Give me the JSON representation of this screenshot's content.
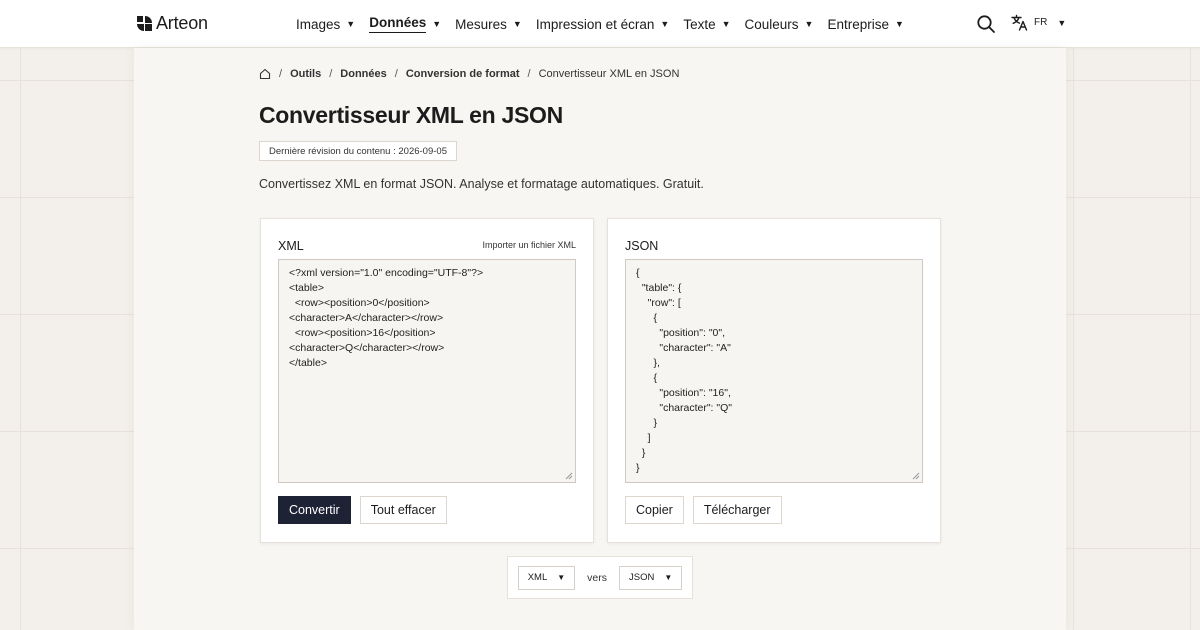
{
  "brand": {
    "name": "Arteon"
  },
  "nav": {
    "items": [
      {
        "label": "Images",
        "active": false
      },
      {
        "label": "Données",
        "active": true
      },
      {
        "label": "Mesures",
        "active": false
      },
      {
        "label": "Impression et écran",
        "active": false
      },
      {
        "label": "Texte",
        "active": false
      },
      {
        "label": "Couleurs",
        "active": false
      },
      {
        "label": "Entreprise",
        "active": false
      }
    ],
    "caret": "▼",
    "language": "FR"
  },
  "breadcrumb": {
    "items": [
      "Outils",
      "Données",
      "Conversion de format"
    ],
    "current": "Convertisseur XML en JSON",
    "separator": "/"
  },
  "page": {
    "title": "Convertisseur XML en JSON",
    "revision": "Dernière révision du contenu : 2026-09-05",
    "intro": "Convertissez XML en format JSON. Analyse et formatage automatiques. Gratuit."
  },
  "xml_panel": {
    "label": "XML",
    "import_link": "Importer un fichier XML",
    "content": "<?xml version=\"1.0\" encoding=\"UTF-8\"?>\n<table>\n  <row><position>0</position>\n<character>A</character></row>\n  <row><position>16</position>\n<character>Q</character></row>\n</table>",
    "convert_label": "Convertir",
    "clear_label": "Tout effacer"
  },
  "json_panel": {
    "label": "JSON",
    "content": "{\n  \"table\": {\n    \"row\": [\n      {\n        \"position\": \"0\",\n        \"character\": \"A\"\n      },\n      {\n        \"position\": \"16\",\n        \"character\": \"Q\"\n      }\n    ]\n  }\n}",
    "copy_label": "Copier",
    "download_label": "Télécharger"
  },
  "converter": {
    "from": "XML",
    "connector": "vers",
    "to": "JSON"
  },
  "colors": {
    "primary_button": "#1e2235",
    "background": "#f3efea"
  }
}
